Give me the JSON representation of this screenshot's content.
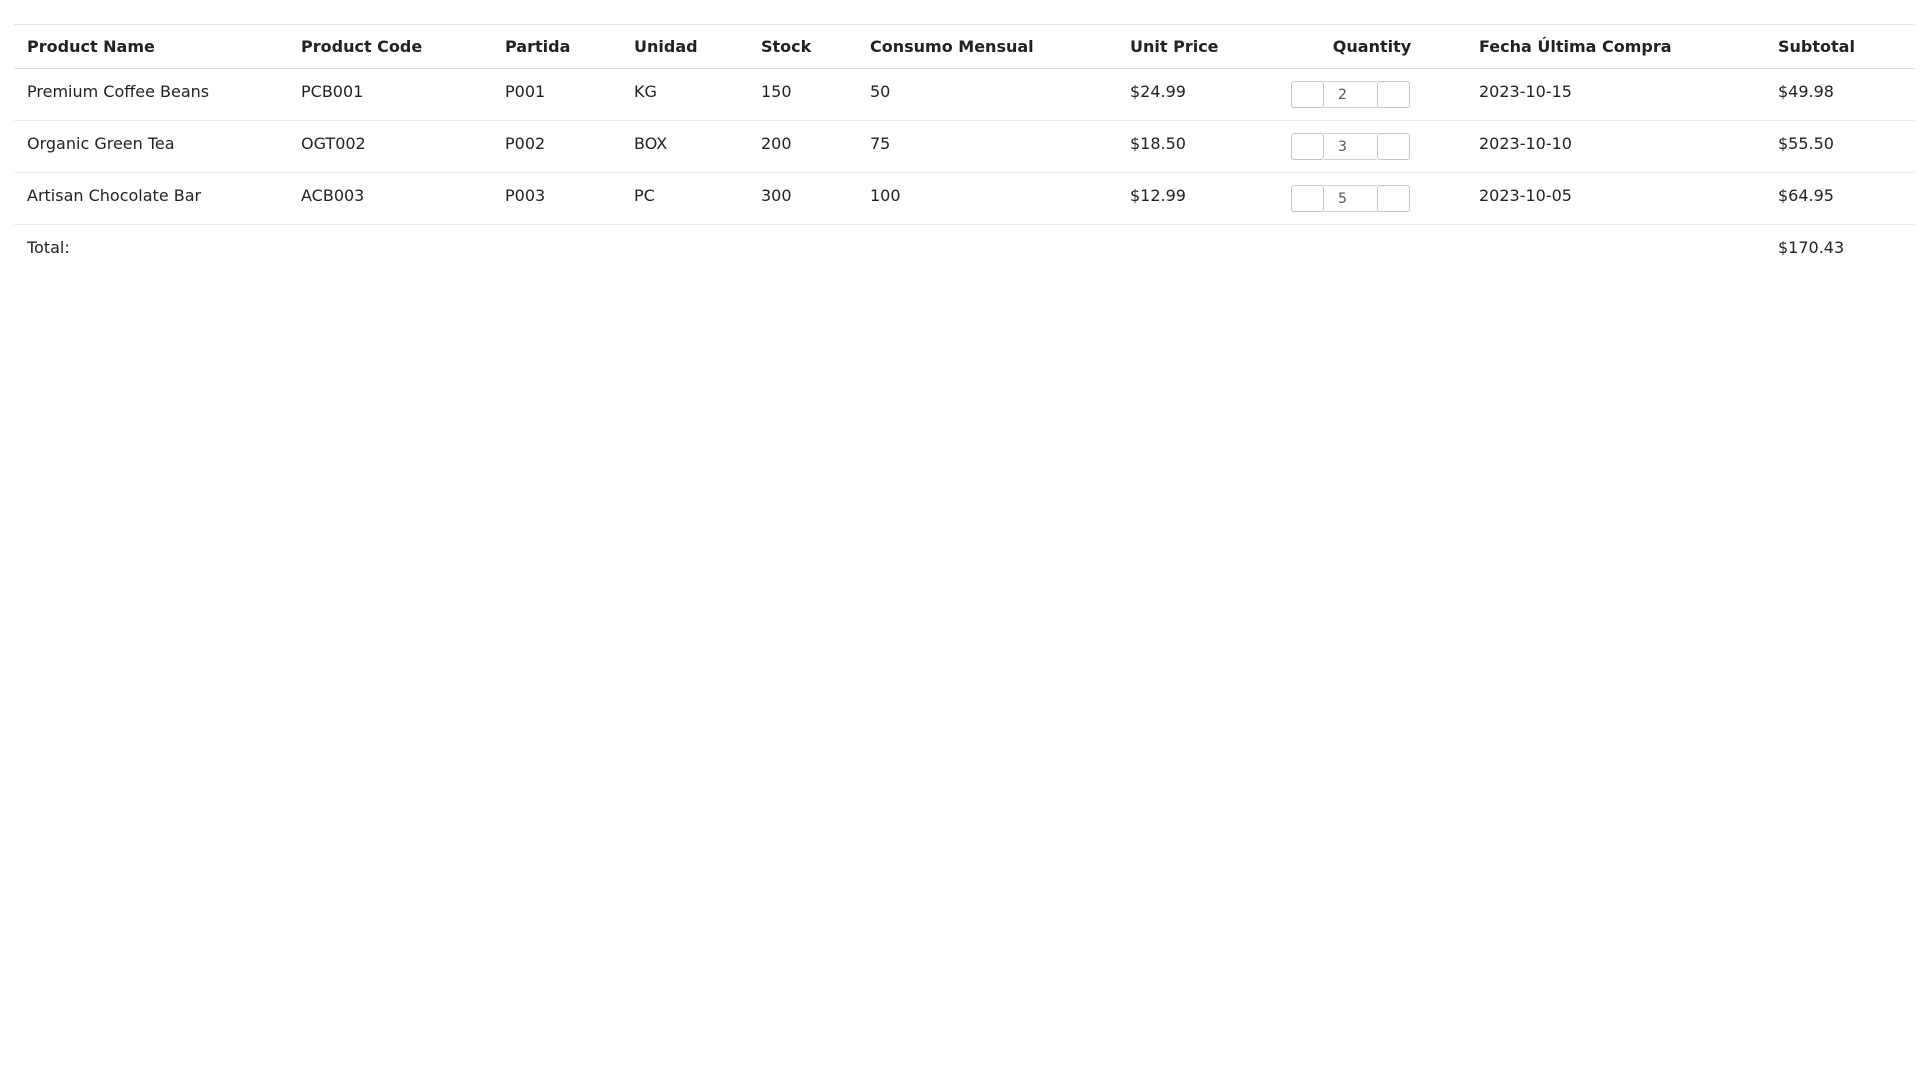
{
  "table": {
    "headers": {
      "product_name": "Product Name",
      "product_code": "Product Code",
      "partida": "Partida",
      "unidad": "Unidad",
      "stock": "Stock",
      "consumo_mensual": "Consumo Mensual",
      "unit_price": "Unit Price",
      "quantity": "Quantity",
      "fecha_ultima_compra": "Fecha Última Compra",
      "subtotal": "Subtotal"
    },
    "rows": [
      {
        "product_name": "Premium Coffee Beans",
        "product_code": "PCB001",
        "partida": "P001",
        "unidad": "KG",
        "stock": "150",
        "consumo_mensual": "50",
        "unit_price": "$24.99",
        "quantity": "2",
        "fecha_ultima_compra": "2023-10-15",
        "subtotal": "$49.98"
      },
      {
        "product_name": "Organic Green Tea",
        "product_code": "OGT002",
        "partida": "P002",
        "unidad": "BOX",
        "stock": "200",
        "consumo_mensual": "75",
        "unit_price": "$18.50",
        "quantity": "3",
        "fecha_ultima_compra": "2023-10-10",
        "subtotal": "$55.50"
      },
      {
        "product_name": "Artisan Chocolate Bar",
        "product_code": "ACB003",
        "partida": "P003",
        "unidad": "PC",
        "stock": "300",
        "consumo_mensual": "100",
        "unit_price": "$12.99",
        "quantity": "5",
        "fecha_ultima_compra": "2023-10-05",
        "subtotal": "$64.95"
      }
    ],
    "total": {
      "label": "Total:",
      "value": "$170.43"
    }
  }
}
